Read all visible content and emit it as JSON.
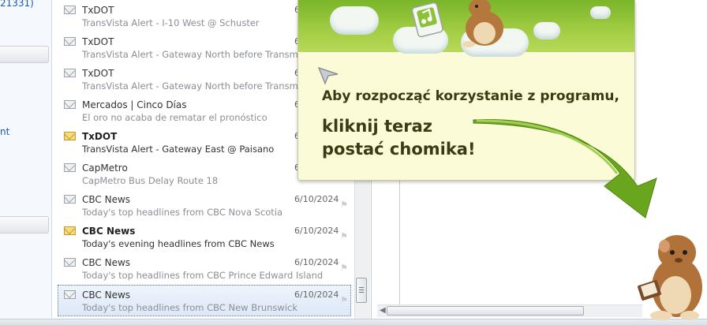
{
  "left_pane": {
    "fragment_top": "21331)",
    "fragment_mid": "nt"
  },
  "messages": [
    {
      "sender": "TxDOT",
      "subject": "TransVista Alert - I-10 West @ Schuster",
      "date": "6",
      "unread": false
    },
    {
      "sender": "TxDOT",
      "subject": "TransVista Alert - Gateway North before Transmoun",
      "date": "6",
      "unread": false
    },
    {
      "sender": "TxDOT",
      "subject": "TransVista Alert - Gateway North before Transmoun",
      "date": "6",
      "unread": false
    },
    {
      "sender": "Mercados | Cinco Días",
      "subject": "El oro no acaba de rematar el pronóstico",
      "date": "6",
      "unread": false
    },
    {
      "sender": "TxDOT",
      "subject": "TransVista Alert - Gateway East @ Paisano",
      "date": "6",
      "unread": true
    },
    {
      "sender": "CapMetro",
      "subject": "CapMetro Bus Delay Route 18",
      "date": "6",
      "unread": false
    },
    {
      "sender": "CBC News",
      "subject": "Today's top headlines from CBC Nova Scotia",
      "date": "6/10/2024",
      "unread": false
    },
    {
      "sender": "CBC News",
      "subject": "Today's evening headlines from CBC News",
      "date": "6/10/2024",
      "unread": true
    },
    {
      "sender": "CBC News",
      "subject": "Today's top headlines from CBC Prince Edward Island",
      "date": "6/10/2024",
      "unread": false
    },
    {
      "sender": "CBC News",
      "subject": "Today's top headlines from CBC New Brunswick",
      "date": "6/10/2024",
      "unread": false,
      "selected": true
    }
  ],
  "promo": {
    "line1": "Aby rozpocząć korzystanie z programu,",
    "line2a": "kliknij teraz",
    "line2b": "postać chomika!"
  },
  "icons": {
    "envelope": "envelope-icon",
    "flag": "flag-icon",
    "music": "music-note-icon",
    "hamster": "hamster-icon",
    "arrow": "green-arrow-icon",
    "cursor": "cursor-icon"
  },
  "colors": {
    "accent_green": "#8cc13a",
    "promo_bg": "#fcfbd8",
    "promo_text": "#3b3a13",
    "selection": "#dde8f7"
  }
}
